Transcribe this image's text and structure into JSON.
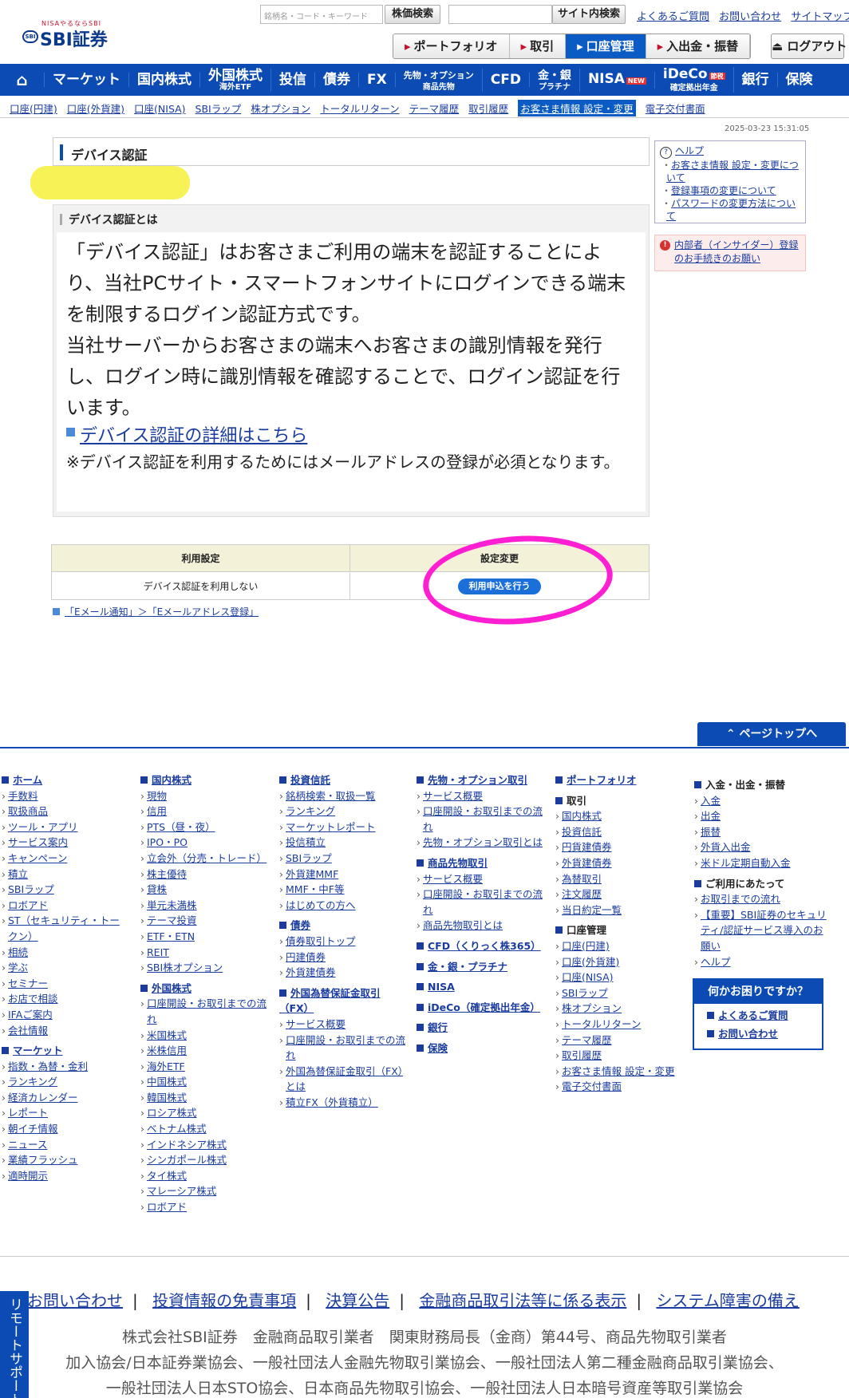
{
  "logo": {
    "tagline": "NISAやるならSBI",
    "mark": "SBI",
    "name": "SBI証券"
  },
  "search": {
    "placeholder": "銘柄名・コード・キーワード",
    "stock_button": "株価検索",
    "site_button": "サイト内検索"
  },
  "top_links": [
    "よくあるご質問",
    "お問い合わせ",
    "サイトマップ"
  ],
  "subnav": [
    "ポートフォリオ",
    "取引",
    "口座管理",
    "入出金・振替"
  ],
  "logout": "ログアウト",
  "main_nav": [
    {
      "label": "マーケット"
    },
    {
      "label": "国内株式"
    },
    {
      "label": "外国株式",
      "sub": "海外ETF"
    },
    {
      "label": "投信"
    },
    {
      "label": "債券"
    },
    {
      "label": "FX"
    },
    {
      "label": "先物・オプション",
      "sub": "商品先物"
    },
    {
      "label": "CFD"
    },
    {
      "label": "金・銀",
      "sub": "プラチナ"
    },
    {
      "label": "NISA",
      "badge": "NEW"
    },
    {
      "label": "iDeCo",
      "sub": "確定拠出年金",
      "badge": "節税"
    },
    {
      "label": "銀行"
    },
    {
      "label": "保険"
    }
  ],
  "sub_tabs": [
    "口座(円建)",
    "口座(外貨建)",
    "口座(NISA)",
    "SBIラップ",
    "株オプション",
    "トータルリターン",
    "テーマ履歴",
    "取引履歴",
    "お客さま情報 設定・変更",
    "電子交付書面"
  ],
  "timestamp": "2025-03-23 15:31:05",
  "page": {
    "title": "デバイス認証",
    "about_heading": "デバイス認証とは",
    "about_text_1": "「デバイス認証」はお客さまご利用の端末を認証することにより、当社PCサイト・スマートフォンサイトにログインできる端末を制限するログイン認証方式です。",
    "about_text_2": "当社サーバーからお客さまの端末へお客さまの識別情報を発行し、ログイン時に識別情報を確認することで、ログイン認証を行います。",
    "detail_link": "デバイス認証の詳細はこちら",
    "note": "※デバイス認証を利用するためにはメールアドレスの登録が必須となります。",
    "settings_headers": [
      "利用設定",
      "設定変更"
    ],
    "current_setting": "デバイス認証を利用しない",
    "apply_button": "利用申込を行う",
    "email_link": "「Eメール通知」＞「Eメールアドレス登録」"
  },
  "sidebar": {
    "help_title": "ヘルプ",
    "help_items": [
      "お客さま情報 設定・変更について",
      "登録事項の変更について",
      "パスワードの変更方法について"
    ],
    "insider": "内部者（インサイダー）登録のお手続きのお願い",
    "insider_icon": "!"
  },
  "page_top": "ページトップへ",
  "footer": {
    "col1": [
      {
        "type": "sec",
        "text": "ホーム"
      },
      "手数料",
      "取扱商品",
      "ツール・アプリ",
      "サービス案内",
      "キャンペーン",
      "積立",
      "SBIラップ",
      "ロボアド",
      "ST（セキュリティ・トークン）",
      "相続",
      "学ぶ",
      "セミナー",
      "お店で相談",
      "IFAご案内",
      "会社情報",
      {
        "type": "sec",
        "text": "マーケット"
      },
      "指数・為替・金利",
      "ランキング",
      "経済カレンダー",
      "レポート",
      "朝イチ情報",
      "ニュース",
      "業績フラッシュ",
      "適時開示"
    ],
    "col2": [
      {
        "type": "sec",
        "text": "国内株式"
      },
      "現物",
      "信用",
      "PTS（昼・夜）",
      "IPO・PO",
      "立会外（分売・トレード）",
      "株主優待",
      "貸株",
      "単元未満株",
      "テーマ投資",
      "ETF・ETN",
      "REIT",
      "SBI株オプション",
      {
        "type": "sec",
        "text": "外国株式"
      },
      "口座開設・お取引までの流れ",
      "米国株式",
      "米株信用",
      "海外ETF",
      "中国株式",
      "韓国株式",
      "ロシア株式",
      "ベトナム株式",
      "インドネシア株式",
      "シンガポール株式",
      "タイ株式",
      "マレーシア株式",
      "ロボアド"
    ],
    "col3": [
      {
        "type": "sec",
        "text": "投資信託"
      },
      "銘柄検索・取扱一覧",
      "ランキング",
      "マーケットレポート",
      "投信積立",
      "SBIラップ",
      "外貨建MMF",
      "MMF・中F等",
      "はじめての方へ",
      {
        "type": "sec",
        "text": "債券"
      },
      "債券取引トップ",
      "円建債券",
      "外貨建債券",
      {
        "type": "sec",
        "text": "外国為替保証金取引（FX）"
      },
      "サービス概要",
      "口座開設・お取引までの流れ",
      "外国為替保証金取引（FX）とは",
      "積立FX（外貨積立）"
    ],
    "col4": [
      {
        "type": "sec",
        "text": "先物・オプション取引"
      },
      "サービス概要",
      "口座開設・お取引までの流れ",
      "先物・オプション取引とは",
      {
        "type": "sec",
        "text": "商品先物取引"
      },
      "サービス概要",
      "口座開設・お取引までの流れ",
      "商品先物取引とは",
      {
        "type": "sec",
        "text": "CFD（くりっく株365）"
      },
      {
        "type": "sec",
        "text": "金・銀・プラチナ"
      },
      {
        "type": "sec",
        "text": "NISA"
      },
      {
        "type": "sec",
        "text": "iDeCo（確定拠出年金）"
      },
      {
        "type": "sec",
        "text": "銀行"
      },
      {
        "type": "sec",
        "text": "保険"
      }
    ],
    "col5": [
      {
        "type": "sec",
        "text": "ポートフォリオ"
      },
      {
        "type": "sub",
        "text": "取引"
      },
      "国内株式",
      "投資信託",
      "円貨建債券",
      "外貨建債券",
      "為替取引",
      "注文履歴",
      "当日約定一覧",
      {
        "type": "sub",
        "text": "口座管理"
      },
      "口座(円建)",
      "口座(外貨建)",
      "口座(NISA)",
      "SBIラップ",
      "株オプション",
      "トータルリターン",
      "テーマ履歴",
      "取引履歴",
      "お客さま情報 設定・変更",
      "電子交付書面"
    ],
    "col6": [
      {
        "type": "sub",
        "text": "入金・出金・振替"
      },
      "入金",
      "出金",
      "振替",
      "外貨入出金",
      "米ドル定期自動入金",
      {
        "type": "sub",
        "text": "ご利用にあたって"
      },
      "お取引までの流れ",
      "【重要】SBI証券のセキュリティ/認証サービス導入のお願い",
      "ヘルプ"
    ],
    "help_panel": {
      "title": "何かお困りですか？",
      "links": [
        "よくあるご質問",
        "お問い合わせ"
      ]
    }
  },
  "bottom_links": [
    "お問い合わせ",
    "投資情報の免責事項",
    "決算公告",
    "金融商品取引法等に係る表示",
    "システム障害の備え"
  ],
  "legal": [
    "株式会社SBI証券　金融商品取引業者　関東財務局長（金商）第44号、商品先物取引業者",
    "加入協会/日本証券業協会、一般社団法人金融先物取引業協会、一般社団法人第二種金融商品取引業協会、",
    "一般社団法人日本STO協会、日本商品先物取引協会、一般社団法人日本暗号資産等取引業協会"
  ],
  "remote_support": "リモートサポート"
}
